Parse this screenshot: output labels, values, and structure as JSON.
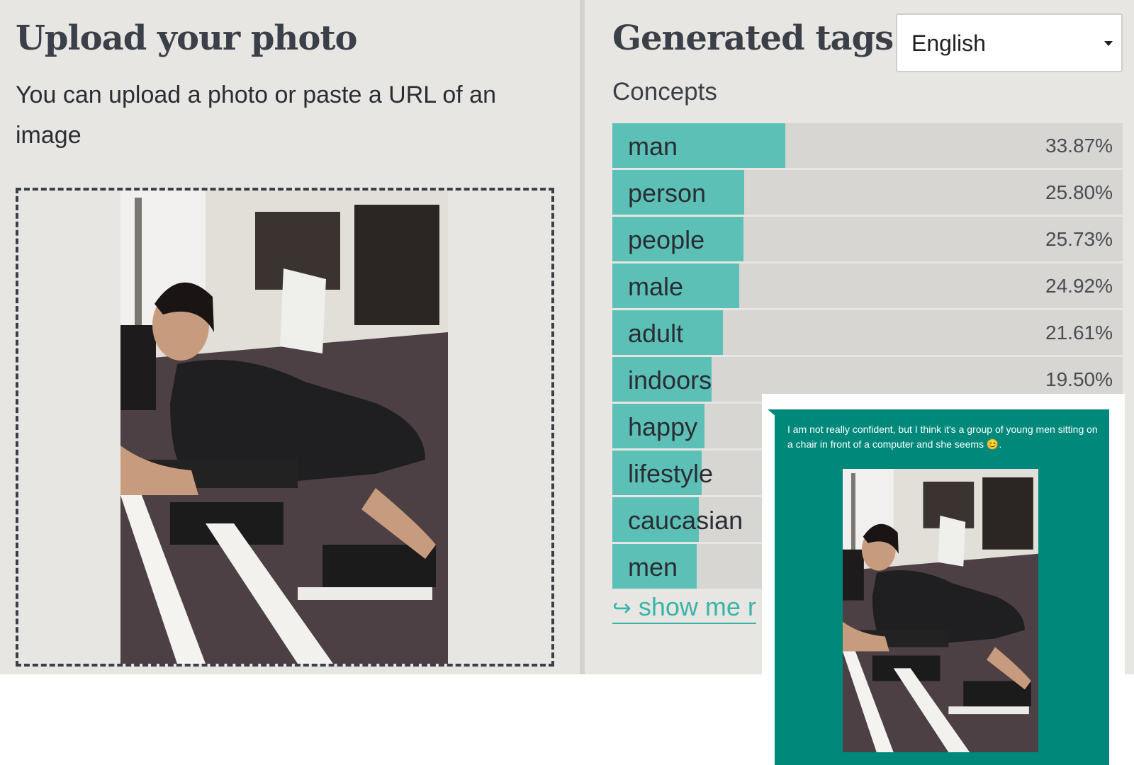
{
  "upload": {
    "title": "Upload your photo",
    "description": "You can upload a photo or paste a URL of an image"
  },
  "tags_panel": {
    "title": "Generated tags",
    "language_select": "English",
    "concepts_label": "Concepts",
    "concepts": [
      {
        "name": "man",
        "percent": "33.87%",
        "fill": 0.3387
      },
      {
        "name": "person",
        "percent": "25.80%",
        "fill": 0.258
      },
      {
        "name": "people",
        "percent": "25.73%",
        "fill": 0.2573
      },
      {
        "name": "male",
        "percent": "24.92%",
        "fill": 0.2492
      },
      {
        "name": "adult",
        "percent": "21.61%",
        "fill": 0.2161
      },
      {
        "name": "indoors",
        "percent": "19.50%",
        "fill": 0.195
      },
      {
        "name": "happy",
        "percent": "",
        "fill": 0.18
      },
      {
        "name": "lifestyle",
        "percent": "",
        "fill": 0.175
      },
      {
        "name": "caucasian",
        "percent": "",
        "fill": 0.17
      },
      {
        "name": "men",
        "percent": "",
        "fill": 0.165
      }
    ],
    "show_more": "show me r"
  },
  "chat_caption": {
    "text": "I am not really confident, but I think it's a group of young men sitting on a chair in front of a computer and she seems 😊."
  },
  "colors": {
    "accent": "#5cc0b6",
    "bar_background": "#d7d6d2",
    "panel_background": "#e7e6e2",
    "caption_bubble": "#00897b"
  }
}
